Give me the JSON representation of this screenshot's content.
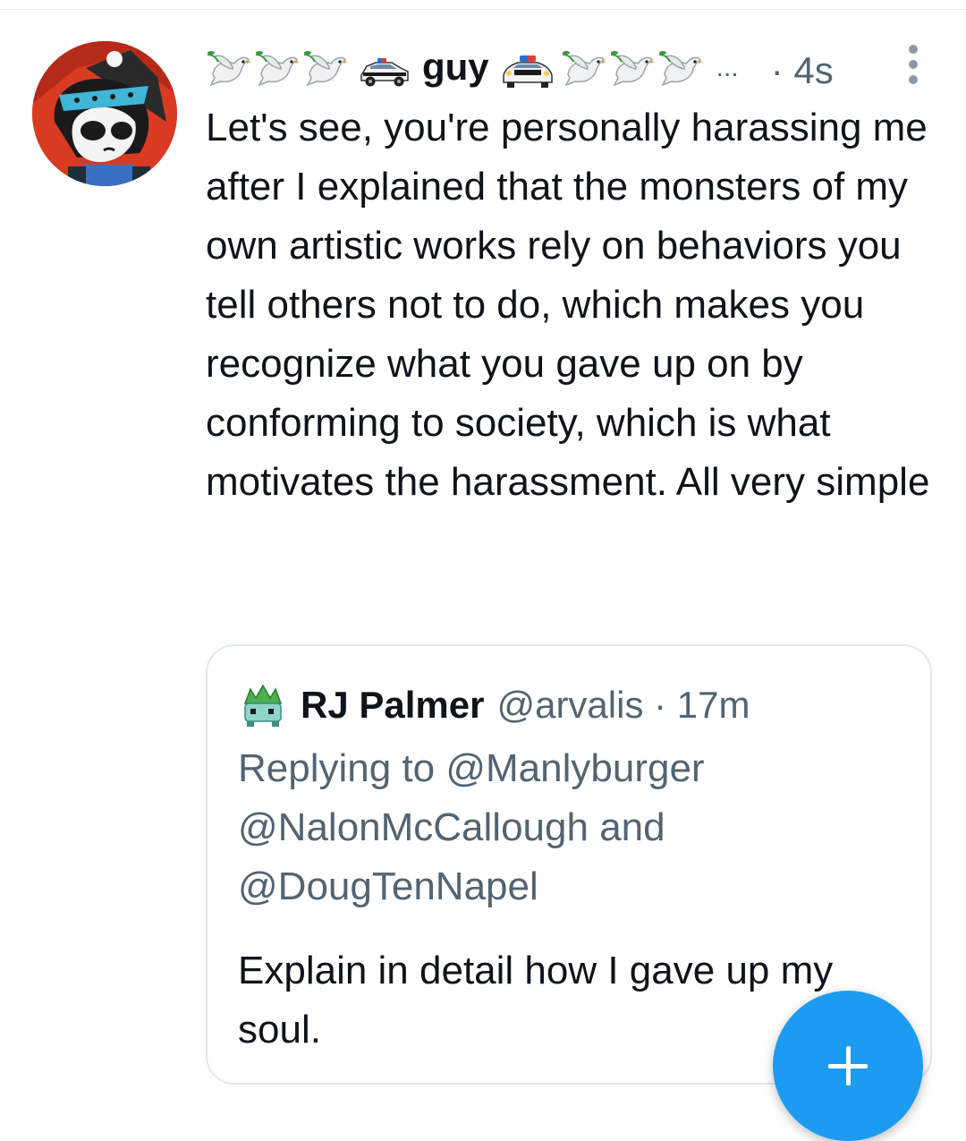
{
  "post": {
    "display_name": "guy",
    "name_truncation": "...",
    "timestamp": "· 4s",
    "body": "Let's see, you're personally harassing me after I explained that the monsters of my own artistic works rely on behaviors you tell others not to do, which makes you recognize what you gave up on by conforming to society, which is what motivates the harassment. All very simple",
    "name_emoji_before": [
      "dove-emoji",
      "dove-emoji",
      "dove-emoji",
      "police-car-emoji"
    ],
    "name_emoji_after": [
      "police-car-emoji",
      "dove-emoji",
      "dove-emoji",
      "dove-emoji"
    ]
  },
  "quote": {
    "name": "RJ Palmer",
    "handle_time": "@arvalis · 17m",
    "replying_prefix": "Replying to ",
    "mention_1": "@Manlyburger",
    "mention_2": "@NalonMcCallough",
    "conjunction": " and ",
    "mention_3": "@DougTenNapel",
    "body": "Explain in detail how I gave up my soul."
  },
  "colors": {
    "accent": "#1d9bf0",
    "text_primary": "#0f1419",
    "text_secondary": "#536471",
    "border": "#e1e8ed"
  },
  "icons": {
    "more": "more-vertical-icon",
    "compose": "plus-icon"
  }
}
